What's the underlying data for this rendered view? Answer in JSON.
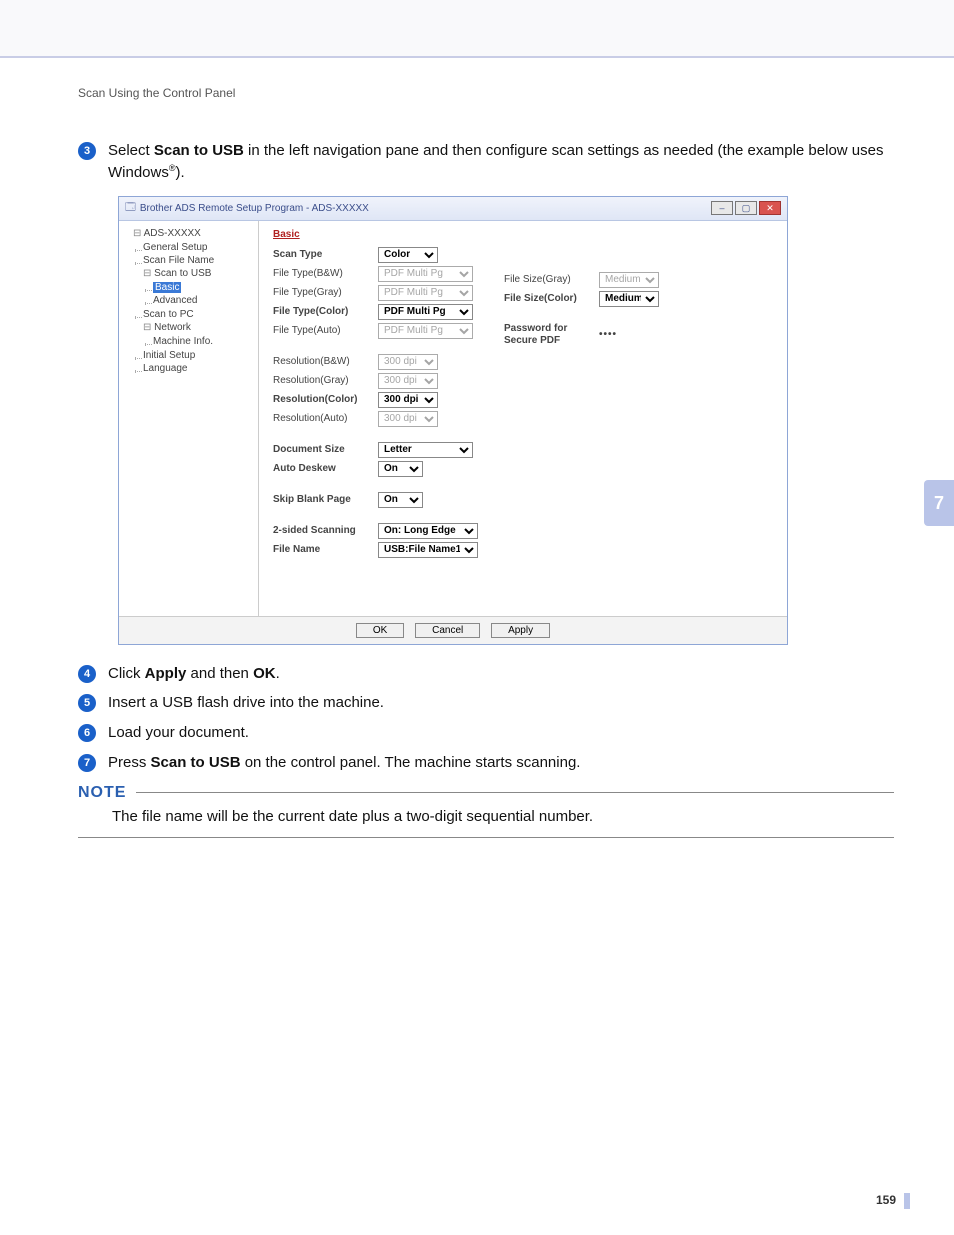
{
  "section_header": "Scan Using the Control Panel",
  "steps": {
    "s3": {
      "num": "3",
      "pre": "Select ",
      "b1": "Scan to USB",
      "post1": " in the left navigation pane and then configure scan settings as needed (the example below uses Windows",
      "sup": "®",
      "post2": ")."
    },
    "s4": {
      "num": "4",
      "pre": "Click ",
      "b1": "Apply",
      "mid": " and then ",
      "b2": "OK",
      "post": "."
    },
    "s5": {
      "num": "5",
      "text": "Insert a USB flash drive into the machine."
    },
    "s6": {
      "num": "6",
      "text": "Load your document."
    },
    "s7": {
      "num": "7",
      "pre": "Press ",
      "b1": "Scan to USB",
      "post": " on the control panel. The machine starts scanning."
    }
  },
  "note": {
    "heading": "NOTE",
    "body": "The file name will be the current date plus a two-digit sequential number."
  },
  "side_tab": "7",
  "page_number": "159",
  "window": {
    "title": "Brother ADS Remote Setup Program - ADS-XXXXX",
    "tree": {
      "root": "ADS-XXXXX",
      "items": [
        "General Setup",
        "Scan File Name",
        "Scan to USB",
        "Basic",
        "Advanced",
        "Scan to PC",
        "Network",
        "Machine Info.",
        "Initial Setup",
        "Language"
      ]
    },
    "heading": "Basic",
    "labels": {
      "scan_type": "Scan Type",
      "ft_bw": "File Type(B&W)",
      "ft_gray": "File Type(Gray)",
      "ft_color": "File Type(Color)",
      "ft_auto": "File Type(Auto)",
      "res_bw": "Resolution(B&W)",
      "res_gray": "Resolution(Gray)",
      "res_color": "Resolution(Color)",
      "res_auto": "Resolution(Auto)",
      "doc_size": "Document Size",
      "auto_deskew": "Auto Deskew",
      "skip_blank": "Skip Blank Page",
      "two_sided": "2-sided Scanning",
      "file_name": "File Name",
      "fs_gray": "File Size(Gray)",
      "fs_color": "File Size(Color)",
      "pw_secure": "Password for Secure PDF"
    },
    "values": {
      "scan_type": "Color",
      "ft_bw": "PDF Multi Pg",
      "ft_gray": "PDF Multi Pg",
      "ft_color": "PDF Multi Pg",
      "ft_auto": "PDF Multi Pg",
      "res_bw": "300 dpi",
      "res_gray": "300 dpi",
      "res_color": "300 dpi",
      "res_auto": "300 dpi",
      "doc_size": "Letter",
      "auto_deskew": "On",
      "skip_blank": "On",
      "two_sided": "On: Long Edge",
      "file_name": "USB:File Name1",
      "fs_gray": "Medium",
      "fs_color": "Medium",
      "pw_secure": "••••"
    },
    "buttons": {
      "ok": "OK",
      "cancel": "Cancel",
      "apply": "Apply"
    }
  }
}
